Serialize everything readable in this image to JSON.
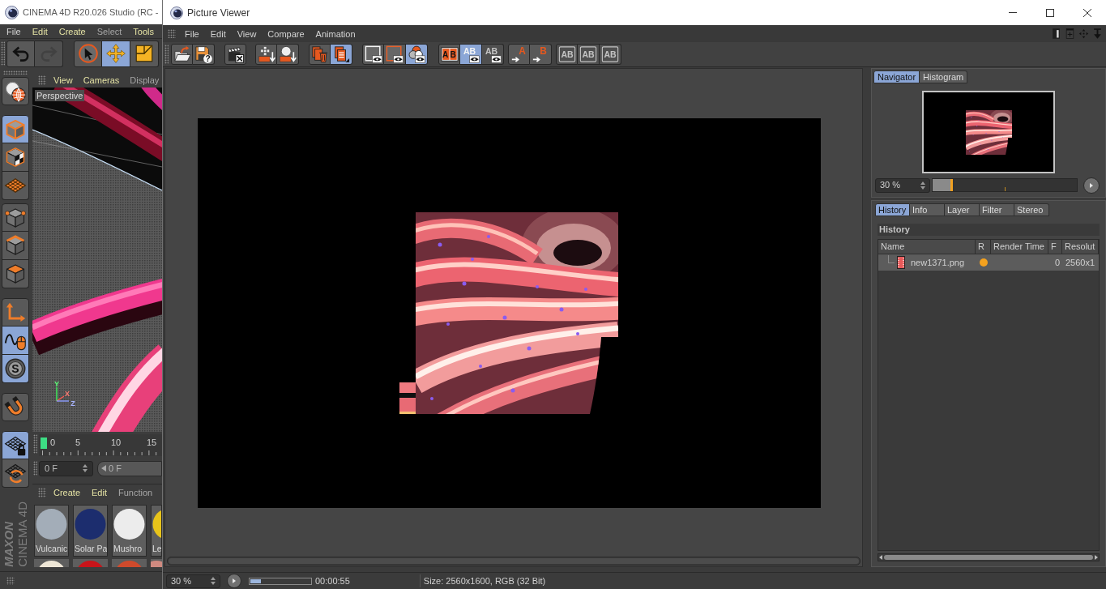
{
  "c4d_window": {
    "title": "CINEMA 4D R20.026 Studio (RC -",
    "menu": [
      {
        "label": "File",
        "color": "#d6d6d6"
      },
      {
        "label": "Edit",
        "color": "#e4e2a4"
      },
      {
        "label": "Create",
        "color": "#e4e2a4"
      },
      {
        "label": "Select",
        "color": "#a6a6a6"
      },
      {
        "label": "Tools",
        "color": "#e4e2a4"
      }
    ],
    "toolbar": [
      [
        {
          "kind": "undo",
          "selected": false,
          "disabled": false
        },
        {
          "kind": "redo",
          "selected": false,
          "disabled": true
        }
      ],
      [
        {
          "kind": "select",
          "selected": false,
          "disabled": false
        },
        {
          "kind": "move",
          "selected": true,
          "disabled": false
        },
        {
          "kind": "scale",
          "selected": false,
          "disabled": false
        }
      ]
    ],
    "palette": [
      [
        {
          "kind": "make-editable",
          "selected": false
        }
      ],
      [
        {
          "kind": "model",
          "selected": true
        },
        {
          "kind": "texture",
          "selected": false
        },
        {
          "kind": "workplane",
          "selected": false
        }
      ],
      [
        {
          "kind": "points",
          "selected": false
        },
        {
          "kind": "edges",
          "selected": false
        },
        {
          "kind": "polygons",
          "selected": false
        }
      ],
      [
        {
          "kind": "axis",
          "selected": false
        },
        {
          "kind": "tweak",
          "selected": true
        },
        {
          "kind": "solo",
          "selected": true,
          "glyph": "S"
        }
      ],
      [
        {
          "kind": "snap",
          "selected": false
        }
      ],
      [
        {
          "kind": "lock-workplane",
          "selected": true
        },
        {
          "kind": "align-workplane",
          "selected": false
        }
      ]
    ],
    "logo": {
      "brand": "MAXON",
      "product": "CINEMA 4D"
    },
    "viewport": {
      "menu": [
        {
          "label": "View",
          "color": "#e4e2a4"
        },
        {
          "label": "Cameras",
          "color": "#e4e2a4"
        },
        {
          "label": "Display",
          "color": "#a6a6a6"
        }
      ],
      "camera": "Perspective",
      "axes": [
        "Y",
        "X",
        "Z"
      ]
    },
    "timeline": {
      "ticks": [
        "0",
        "5",
        "10",
        "15"
      ]
    },
    "frame_fields": [
      {
        "kind": "spinner",
        "value": "0 F"
      },
      {
        "kind": "slider",
        "value": "0 F"
      }
    ],
    "material_manager": {
      "menu": [
        {
          "label": "Create",
          "color": "#e4e2a4"
        },
        {
          "label": "Edit",
          "color": "#e4e2a4"
        },
        {
          "label": "Function",
          "color": "#a6a6a6"
        }
      ],
      "materials": [
        {
          "name": "Vulcanic",
          "color": "#a3adb8"
        },
        {
          "name": "Solar Pa",
          "color": "#1c2d6e"
        },
        {
          "name": "Mushro",
          "color": "#ececec"
        },
        {
          "name": "Le",
          "color": "#e8c41a"
        }
      ],
      "next_row": [
        {
          "color": "#eee6d6"
        },
        {
          "color": "#c8141a"
        },
        {
          "color": "#cf4a2c"
        },
        {
          "color": "#d08a80"
        }
      ]
    }
  },
  "picture_viewer": {
    "title": "Picture Viewer",
    "window_controls": [
      {
        "kind": "minimize"
      },
      {
        "kind": "maximize"
      },
      {
        "kind": "close"
      }
    ],
    "menu": [
      "File",
      "Edit",
      "View",
      "Compare",
      "Animation"
    ],
    "layout_icons": [
      {
        "kind": "split-panel"
      },
      {
        "kind": "add-panel"
      },
      {
        "kind": "move-panel"
      },
      {
        "kind": "collapse"
      }
    ],
    "toolbar": [
      [
        {
          "kind": "open",
          "selected": false,
          "disabled": false
        },
        {
          "kind": "save",
          "glyph": "?",
          "selected": false,
          "disabled": false
        }
      ],
      [
        {
          "kind": "clear-clapper",
          "selected": false,
          "disabled": false
        }
      ],
      [
        {
          "kind": "grid-down",
          "selected": false,
          "disabled": false
        },
        {
          "kind": "sphere-down",
          "selected": false,
          "disabled": false
        }
      ],
      [
        {
          "kind": "delete-stack",
          "selected": false,
          "disabled": false
        },
        {
          "kind": "stack",
          "selected": true,
          "disabled": false
        }
      ],
      [
        {
          "kind": "frame-white",
          "selected": false,
          "disabled": false
        },
        {
          "kind": "frame-orange",
          "selected": false,
          "disabled": false
        },
        {
          "kind": "channels",
          "selected": true,
          "disabled": false
        }
      ],
      [
        {
          "kind": "ab-split",
          "glyph": "AB",
          "selected": false,
          "disabled": false
        },
        {
          "kind": "ab-overlay",
          "glyph": "AB",
          "selected": true,
          "disabled": false
        },
        {
          "kind": "ab-difference",
          "glyph": "AB",
          "selected": false,
          "disabled": true
        }
      ],
      [
        {
          "kind": "set-a",
          "glyph": "A",
          "selected": false,
          "disabled": false
        },
        {
          "kind": "set-b",
          "glyph": "B",
          "selected": false,
          "disabled": false
        }
      ],
      [
        {
          "kind": "ab-swap",
          "glyph": "AB",
          "selected": false,
          "disabled": true
        },
        {
          "kind": "ab-stack",
          "glyph": "AB",
          "selected": false,
          "disabled": true
        },
        {
          "kind": "ab-arrows",
          "glyph": "AB",
          "selected": false,
          "disabled": true
        }
      ]
    ],
    "navigator": {
      "tabs": [
        {
          "label": "Navigator",
          "selected": true
        },
        {
          "label": "Histogram",
          "selected": false
        }
      ],
      "zoom": "30 %",
      "slider": {
        "level": 0.13
      }
    },
    "history": {
      "tabs": [
        {
          "label": "History",
          "selected": true
        },
        {
          "label": "Info",
          "selected": false
        },
        {
          "label": "Layer",
          "selected": false
        },
        {
          "label": "Filter",
          "selected": false
        },
        {
          "label": "Stereo",
          "selected": false
        }
      ],
      "title": "History",
      "columns": [
        "Name",
        "R",
        "Render Time",
        "F",
        "Resolut"
      ],
      "rows": [
        {
          "name": "new1371.png",
          "color": "#f5a21e",
          "frame": "0",
          "resolution": "2560x1",
          "selected": true
        }
      ]
    },
    "status_bar": {
      "zoom": "30 %",
      "progress": {
        "level": 0.17
      },
      "time": "00:00:55",
      "info": "Size: 2560x1600, RGB (32 Bit)"
    }
  }
}
